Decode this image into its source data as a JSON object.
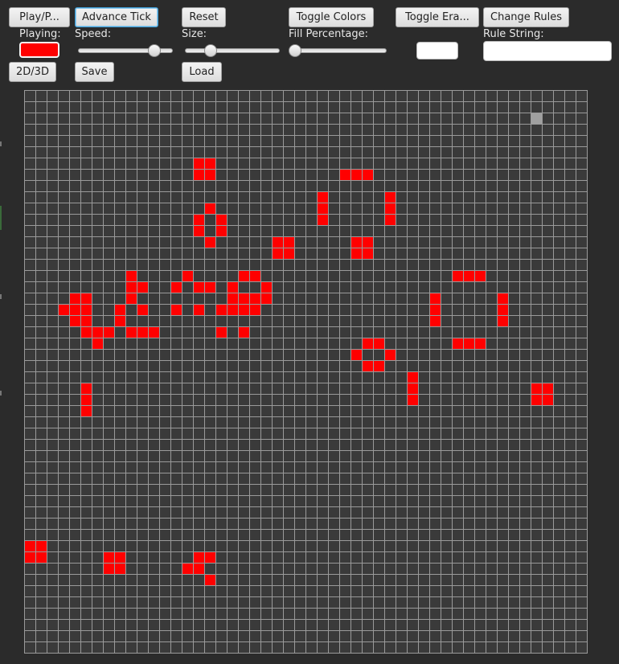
{
  "toolbar": {
    "play_pause": "Play/P...",
    "advance_tick": "Advance Tick",
    "reset": "Reset",
    "toggle_colors": "Toggle Colors",
    "toggle_eraser": "Toggle Era...",
    "change_rules": "Change Rules",
    "toggle_2d3d": "2D/3D",
    "save": "Save",
    "load": "Load"
  },
  "labels": {
    "playing": "Playing:",
    "speed": "Speed:",
    "size": "Size:",
    "fill_percentage": "Fill Percentage:",
    "rule_string": "Rule String:"
  },
  "sliders": {
    "speed": 0.85,
    "size": 0.24,
    "fill_percentage": 0.0
  },
  "inputs": {
    "color_value": "",
    "rule_string": ""
  },
  "colors": {
    "background": "#2b2b2b",
    "grid_line": "#9a9a9a",
    "dead_cell": "#3a3a3a",
    "live_cell": "#ff0000",
    "cursor_cell": "#a0a0a0",
    "playing_indicator": "#ff0000"
  },
  "grid": {
    "cols": 50,
    "rows": 50,
    "cursor": [
      45,
      2
    ],
    "live_cells": [
      [
        15,
        6
      ],
      [
        16,
        6
      ],
      [
        15,
        7
      ],
      [
        16,
        7
      ],
      [
        28,
        7
      ],
      [
        29,
        7
      ],
      [
        30,
        7
      ],
      [
        26,
        9
      ],
      [
        32,
        9
      ],
      [
        26,
        10
      ],
      [
        32,
        10
      ],
      [
        26,
        11
      ],
      [
        32,
        11
      ],
      [
        16,
        10
      ],
      [
        15,
        11
      ],
      [
        17,
        11
      ],
      [
        15,
        12
      ],
      [
        17,
        12
      ],
      [
        16,
        13
      ],
      [
        22,
        13
      ],
      [
        23,
        13
      ],
      [
        29,
        13
      ],
      [
        30,
        13
      ],
      [
        22,
        14
      ],
      [
        23,
        14
      ],
      [
        29,
        14
      ],
      [
        30,
        14
      ],
      [
        38,
        16
      ],
      [
        39,
        16
      ],
      [
        40,
        16
      ],
      [
        9,
        16
      ],
      [
        14,
        16
      ],
      [
        19,
        16
      ],
      [
        20,
        16
      ],
      [
        9,
        17
      ],
      [
        10,
        17
      ],
      [
        13,
        17
      ],
      [
        15,
        17
      ],
      [
        16,
        17
      ],
      [
        18,
        17
      ],
      [
        21,
        17
      ],
      [
        4,
        18
      ],
      [
        5,
        18
      ],
      [
        9,
        18
      ],
      [
        18,
        18
      ],
      [
        19,
        18
      ],
      [
        20,
        18
      ],
      [
        21,
        18
      ],
      [
        36,
        18
      ],
      [
        42,
        18
      ],
      [
        3,
        19
      ],
      [
        4,
        19
      ],
      [
        5,
        19
      ],
      [
        8,
        19
      ],
      [
        10,
        19
      ],
      [
        13,
        19
      ],
      [
        15,
        19
      ],
      [
        17,
        19
      ],
      [
        18,
        19
      ],
      [
        19,
        19
      ],
      [
        20,
        19
      ],
      [
        36,
        19
      ],
      [
        42,
        19
      ],
      [
        4,
        20
      ],
      [
        5,
        20
      ],
      [
        8,
        20
      ],
      [
        36,
        20
      ],
      [
        42,
        20
      ],
      [
        5,
        21
      ],
      [
        6,
        21
      ],
      [
        7,
        21
      ],
      [
        9,
        21
      ],
      [
        10,
        21
      ],
      [
        11,
        21
      ],
      [
        17,
        21
      ],
      [
        19,
        21
      ],
      [
        6,
        22
      ],
      [
        38,
        22
      ],
      [
        39,
        22
      ],
      [
        40,
        22
      ],
      [
        30,
        22
      ],
      [
        31,
        22
      ],
      [
        29,
        23
      ],
      [
        32,
        23
      ],
      [
        30,
        24
      ],
      [
        31,
        24
      ],
      [
        34,
        25
      ],
      [
        34,
        26
      ],
      [
        34,
        27
      ],
      [
        5,
        26
      ],
      [
        5,
        27
      ],
      [
        5,
        28
      ],
      [
        45,
        26
      ],
      [
        46,
        26
      ],
      [
        45,
        27
      ],
      [
        46,
        27
      ],
      [
        0,
        40
      ],
      [
        1,
        40
      ],
      [
        0,
        41
      ],
      [
        1,
        41
      ],
      [
        7,
        41
      ],
      [
        8,
        41
      ],
      [
        7,
        42
      ],
      [
        8,
        42
      ],
      [
        15,
        41
      ],
      [
        16,
        41
      ],
      [
        14,
        42
      ],
      [
        15,
        42
      ],
      [
        16,
        43
      ]
    ]
  }
}
